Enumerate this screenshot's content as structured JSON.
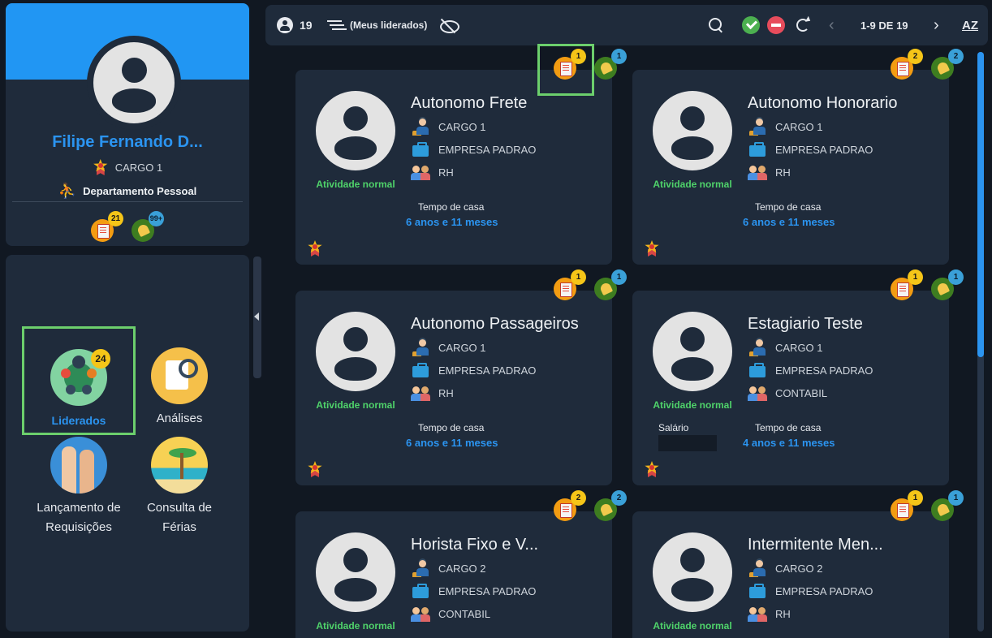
{
  "profile": {
    "name": "Filipe Fernando D...",
    "role": "CARGO 1",
    "department": "Departamento Pessoal",
    "task_count": "21",
    "alert_count": "99+"
  },
  "menu": {
    "liderados": {
      "label": "Liderados",
      "badge": "24"
    },
    "analises": {
      "label": "Análises"
    },
    "lancamento": {
      "label_line1": "Lançamento de",
      "label_line2": "Requisições"
    },
    "ferias": {
      "label_line1": "Consulta de",
      "label_line2": "Férias"
    }
  },
  "toolbar": {
    "user_count": "19",
    "filter_label": "(Meus liderados)",
    "pagination": "1-9 DE 19",
    "sort_label": "AZ",
    "icons": [
      "user-icon",
      "filter-icon",
      "eye-off-icon",
      "search-icon",
      "check-icon",
      "minus-icon",
      "refresh-icon",
      "chevron-left-icon",
      "chevron-right-icon",
      "sort-az-icon"
    ]
  },
  "cards": [
    {
      "name": "Autonomo Frete",
      "role": "CARGO 1",
      "company": "EMPRESA PADRAO",
      "dept": "RH",
      "status": "Atividade normal",
      "tenure_label": "Tempo de casa",
      "tenure": "6 anos e 11 meses",
      "tasks": "1",
      "alerts": "1"
    },
    {
      "name": "Autonomo Honorario",
      "role": "CARGO 1",
      "company": "EMPRESA PADRAO",
      "dept": "RH",
      "status": "Atividade normal",
      "tenure_label": "Tempo de casa",
      "tenure": "6 anos e 11 meses",
      "tasks": "2",
      "alerts": "2"
    },
    {
      "name": "Autonomo Passageiros",
      "role": "CARGO 1",
      "company": "EMPRESA PADRAO",
      "dept": "RH",
      "status": "Atividade normal",
      "tenure_label": "Tempo de casa",
      "tenure": "6 anos e 11 meses",
      "tasks": "1",
      "alerts": "1"
    },
    {
      "name": "Estagiario Teste",
      "role": "CARGO 1",
      "company": "EMPRESA PADRAO",
      "dept": "CONTABIL",
      "status": "Atividade normal",
      "salary_label": "Salário",
      "tenure_label": "Tempo de casa",
      "tenure": "4 anos e 11 meses",
      "tasks": "1",
      "alerts": "1"
    },
    {
      "name": "Horista Fixo e V...",
      "role": "CARGO 2",
      "company": "EMPRESA PADRAO",
      "dept": "CONTABIL",
      "status": "Atividade normal",
      "tasks": "2",
      "alerts": "2"
    },
    {
      "name": "Intermitente Men...",
      "role": "CARGO 2",
      "company": "EMPRESA PADRAO",
      "dept": "RH",
      "status": "Atividade normal",
      "tasks": "1",
      "alerts": "1"
    }
  ],
  "colors": {
    "accent": "#2196f3",
    "panel": "#1f2b3b",
    "background": "#111822",
    "status_green": "#4fd36a",
    "highlight": "#6ccf6c"
  }
}
